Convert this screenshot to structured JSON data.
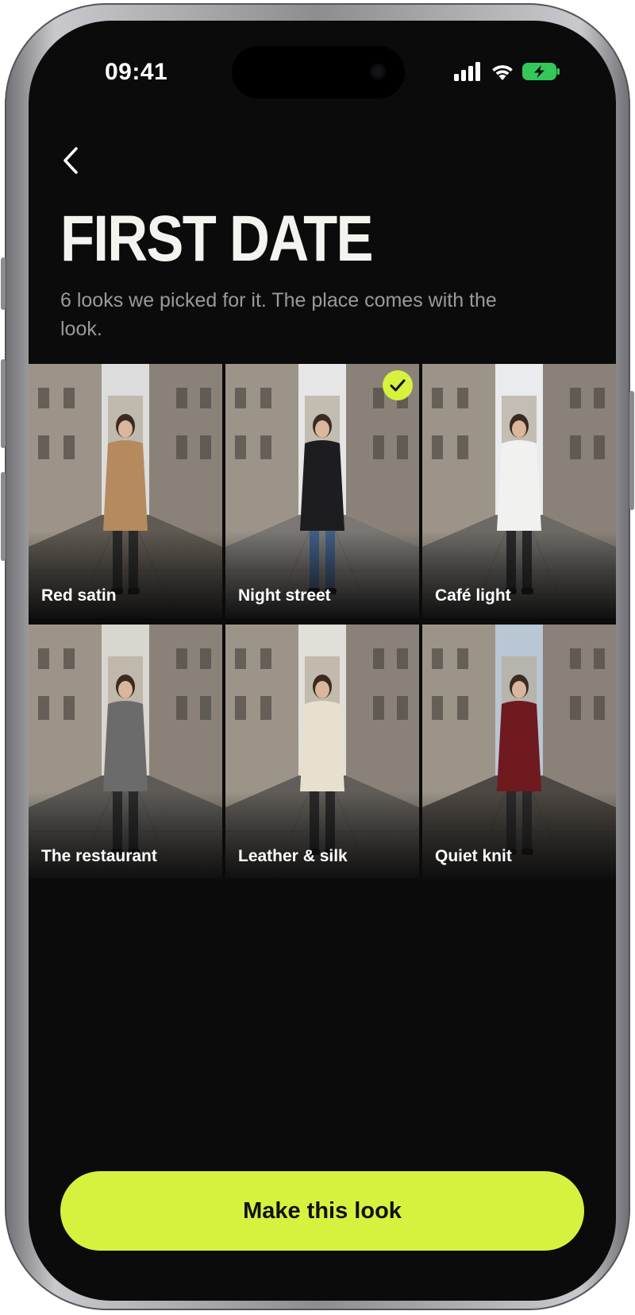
{
  "status_bar": {
    "time": "09:41",
    "icons": [
      "cellular-signal-icon",
      "wifi-icon",
      "battery-charging-icon"
    ]
  },
  "header": {
    "back_icon": "chevron-left-icon",
    "title": "FIRST DATE",
    "subtitle": "6 looks we picked for it. The place comes with the look."
  },
  "looks": [
    {
      "label": "Red satin",
      "selected": false,
      "outfit": "camel-coat",
      "colors": {
        "outfit": "#b58a5e",
        "sky": "#dcdcdc",
        "street": "#5f5a52"
      }
    },
    {
      "label": "Night street",
      "selected": true,
      "outfit": "leather-jacket-jeans",
      "colors": {
        "outfit": "#1d1d1f",
        "sky": "#e6e6e6",
        "street": "#7a7774"
      }
    },
    {
      "label": "Café light",
      "selected": false,
      "outfit": "white-dress",
      "colors": {
        "outfit": "#f1f1ef",
        "sky": "#e9ebee",
        "street": "#6d6a66"
      }
    },
    {
      "label": "The restaurant",
      "selected": false,
      "outfit": "grey-blazer",
      "colors": {
        "outfit": "#6b6b6b",
        "sky": "#d9d6cf",
        "street": "#5e5b57"
      }
    },
    {
      "label": "Leather & silk",
      "selected": false,
      "outfit": "cream-knit-green-skirt",
      "colors": {
        "outfit": "#e8e0cf",
        "sky": "#e2dfd8",
        "street": "#615d58"
      }
    },
    {
      "label": "Quiet knit",
      "selected": false,
      "outfit": "burgundy-slip-dress",
      "colors": {
        "outfit": "#6e1a1f",
        "sky": "#b9c6d3",
        "street": "#4d4843"
      }
    }
  ],
  "selected_icon": "checkmark-icon",
  "cta": {
    "label": "Make this look"
  },
  "colors": {
    "accent": "#d7f23e",
    "background": "#0b0b0b",
    "title": "#f3f3ef",
    "subtitle": "#9a9a9a"
  }
}
